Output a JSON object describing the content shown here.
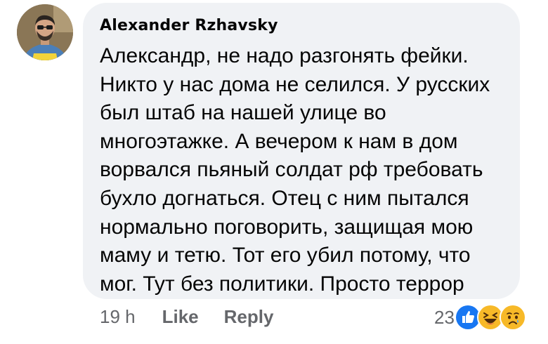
{
  "comment": {
    "author": "Alexander Rzhavsky",
    "lines": [
      "Александр, не надо разгонять фейки.",
      "Никто у нас дома не селился. У русских",
      "был штаб на нашей улице во",
      "многоэтажке. А вечером к нам в дом",
      "ворвался пьяный солдат рф требовать",
      "бухло догнаться. Отец с ним пытался",
      "нормально поговорить, защищая мою",
      "маму и тетю. Тот его убил потому, что",
      "мог. Тут без политики. Просто террор"
    ]
  },
  "actions": {
    "time": "19 h",
    "like_label": "Like",
    "reply_label": "Reply"
  },
  "reactions": {
    "count": "23",
    "icons": [
      "like-icon",
      "haha-icon",
      "sad-icon"
    ]
  },
  "colors": {
    "bubble": "#f0f2f5",
    "text": "#050505",
    "secondary": "#65676b",
    "like_blue": "#1877f2",
    "emoji_yellow": "#f7b928"
  }
}
